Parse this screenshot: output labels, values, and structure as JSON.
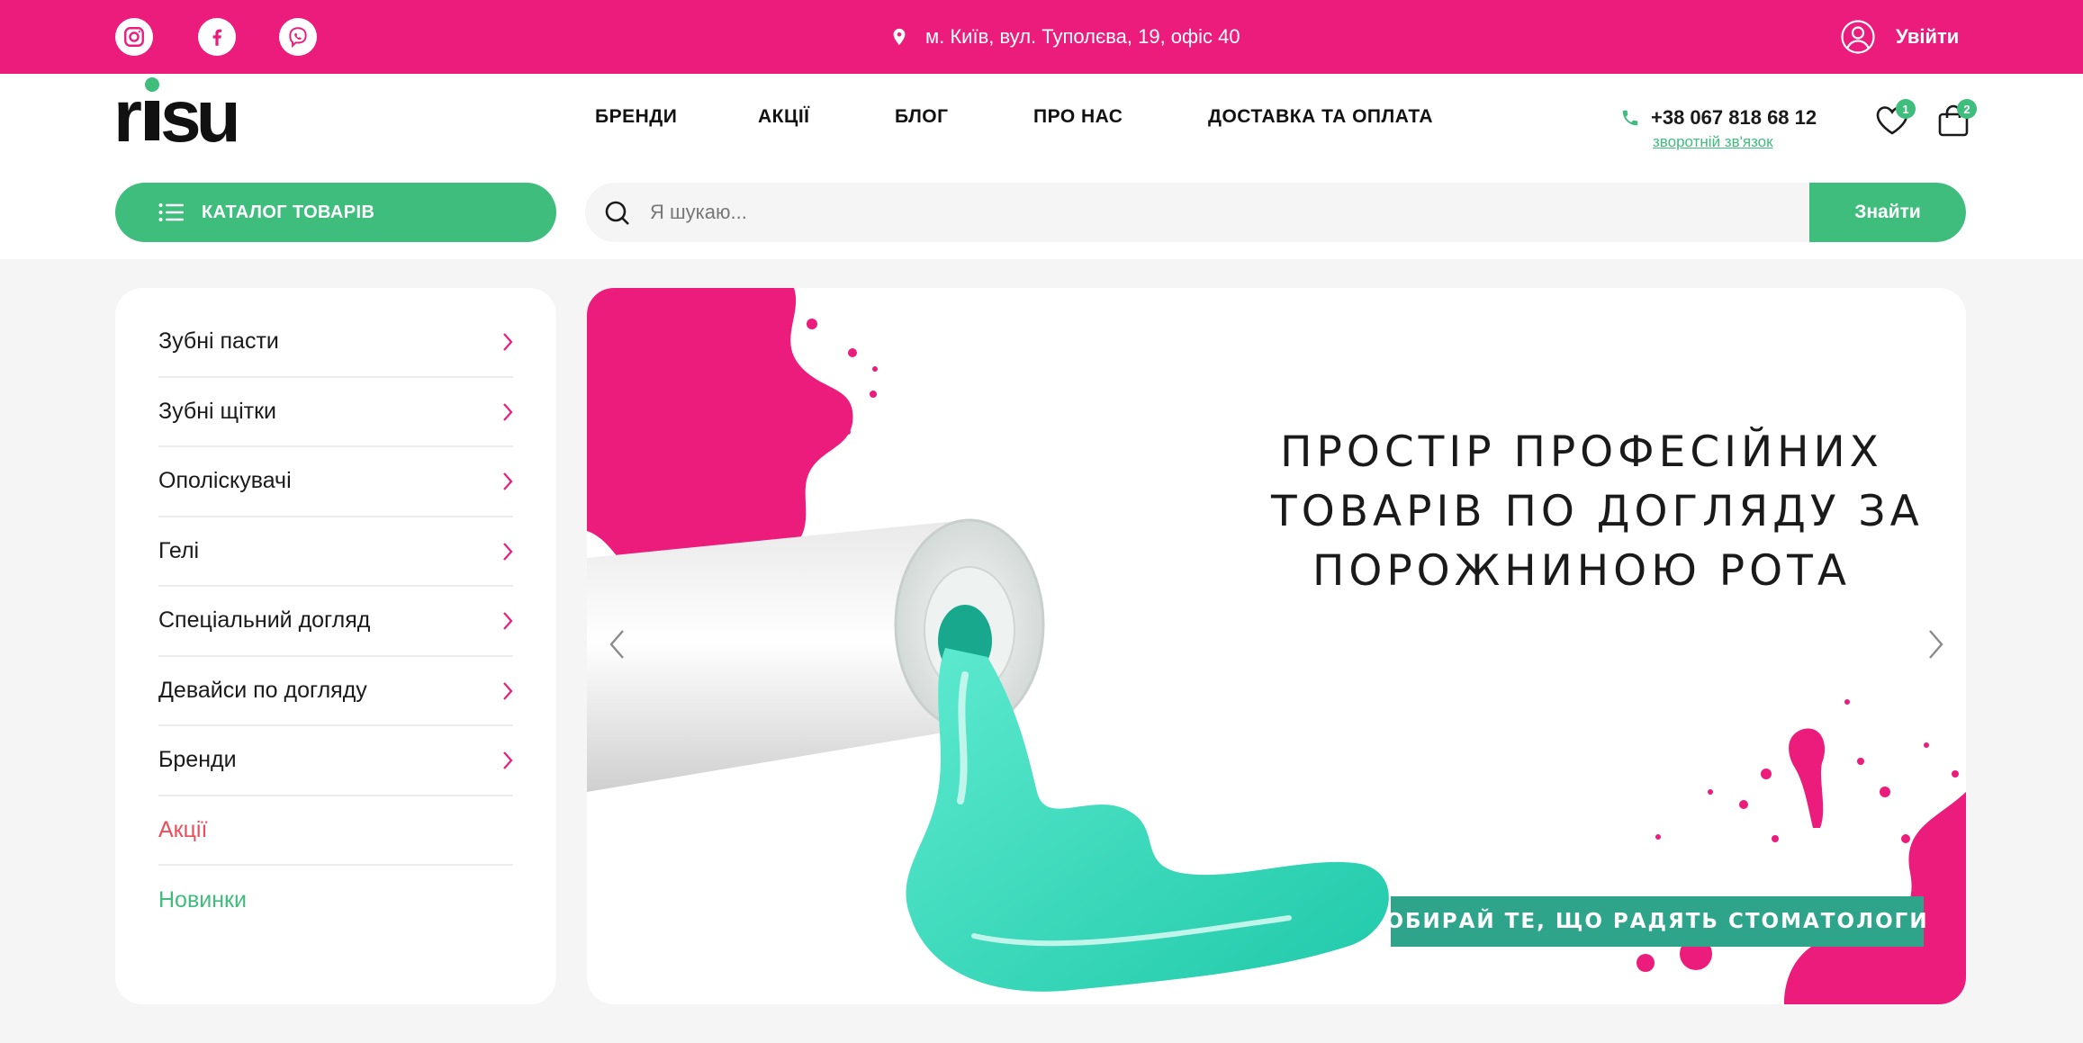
{
  "topbar": {
    "address": "м. Київ, вул. Туполєва, 19, офіс 40",
    "login_label": "Увійти",
    "social": [
      "instagram-icon",
      "facebook-icon",
      "viber-icon"
    ],
    "color": "#ec1c7c"
  },
  "header": {
    "logo": "risu",
    "nav": [
      {
        "label": "БРЕНДИ"
      },
      {
        "label": "АКЦІЇ"
      },
      {
        "label": "БЛОГ"
      },
      {
        "label": "ПРО НАС"
      },
      {
        "label": "ДОСТАВКА ТА ОПЛАТА"
      }
    ],
    "phone": "+38 067 818 68 12",
    "callback_label": "зворотній зв'язок",
    "wishlist_count": "1",
    "cart_count": "2"
  },
  "catalog": {
    "label": "КАТАЛОГ ТОВАРІВ"
  },
  "search": {
    "placeholder": "Я шукаю...",
    "button_label": "Знайти"
  },
  "sidebar": {
    "items": [
      {
        "label": "Зубні пасти"
      },
      {
        "label": "Зубні щітки"
      },
      {
        "label": "Ополіскувачі"
      },
      {
        "label": "Гелі"
      },
      {
        "label": "Спеціальний догляд"
      },
      {
        "label": "Девайси по догляду"
      },
      {
        "label": "Бренди"
      },
      {
        "label": "Акції"
      },
      {
        "label": "Новинки"
      }
    ]
  },
  "banner": {
    "headline": [
      "ПРОСТІР ПРОФЕСІЙНИХ",
      "ТОВАРІВ ПО ДОГЛЯДУ ЗА",
      "ПОРОЖНИНОЮ РОТА"
    ],
    "cta": "ОБИРАЙ ТЕ, ЩО РАДЯТЬ СТОМАТОЛОГИ"
  },
  "colors": {
    "accent": "#3ebd7c",
    "brand_pink": "#ec1c7c",
    "sale": "#ef4b5a",
    "cta_bg": "#2ea58a"
  }
}
